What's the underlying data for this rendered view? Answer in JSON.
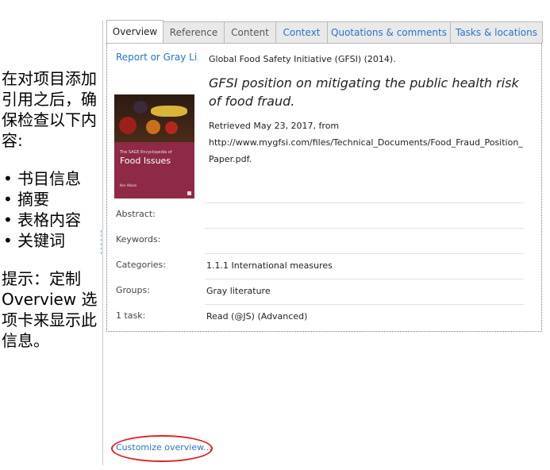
{
  "annotation": {
    "intro": "在对项目添加引用之后，确保检查以下内容:",
    "items": [
      "书目信息",
      "摘要",
      "表格内容",
      "关键词"
    ],
    "tip": "提示：定制 Overview 选项卡来显示此信息。"
  },
  "tabs": [
    {
      "label": "Overview",
      "active": true
    },
    {
      "label": "Reference",
      "active": false
    },
    {
      "label": "Content",
      "active": false
    },
    {
      "label": "Context",
      "active": false
    },
    {
      "label": "Quotations & comments",
      "active": false
    },
    {
      "label": "Tasks & locations",
      "active": false
    }
  ],
  "reference": {
    "type_link": "Report or Gray Li...",
    "author_line": "Global Food Safety Initiative (GFSI) (2014).",
    "title": "GFSI position on mitigating the public health risk of food fraud.",
    "retrieved": "Retrieved May 23, 2017, from",
    "url": "http://www.mygfsi.com/files/Technical_Documents/Food_Fraud_Position_Paper.pdf."
  },
  "cover": {
    "series": "The SAGE Encyclopedia of",
    "title": "Food Issues",
    "editor": "Ken Albala"
  },
  "fields": [
    {
      "label": "Abstract:",
      "value": ""
    },
    {
      "label": "Keywords:",
      "value": ""
    },
    {
      "label": "Categories:",
      "value": "1.1.1 International measures"
    },
    {
      "label": "Groups:",
      "value": "Gray literature"
    },
    {
      "label": "1 task:",
      "value": "Read (@JS) (Advanced)"
    }
  ],
  "customize_link": "Customize overview...",
  "colors": {
    "link": "#2a73c9",
    "highlight_ring": "#e02020",
    "cover": "#8e2a45"
  }
}
